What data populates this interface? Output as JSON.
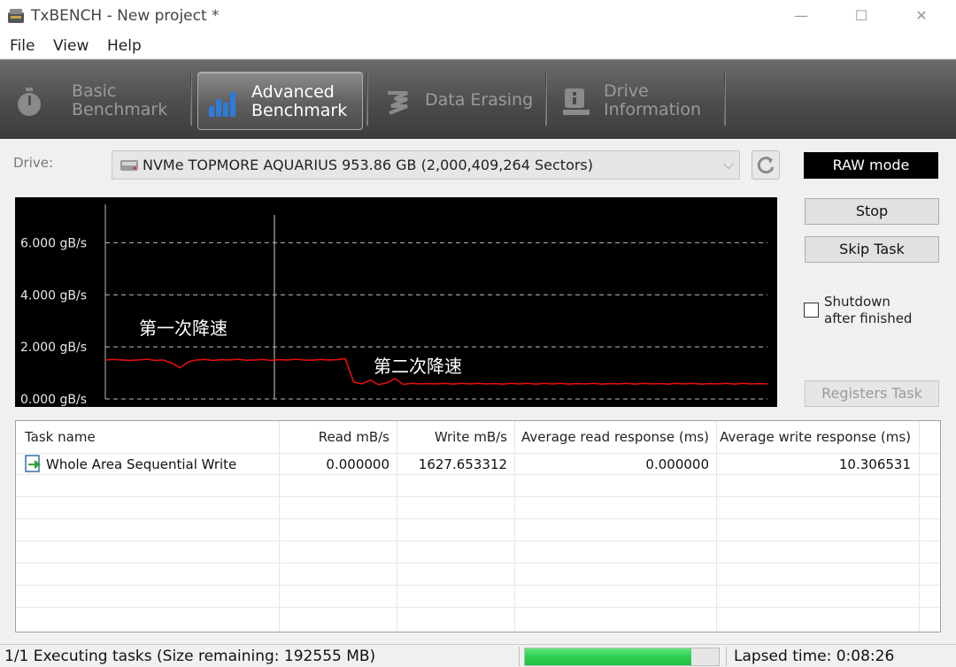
{
  "window": {
    "title": "TxBENCH - New project *",
    "minimize_glyph": "—",
    "maximize_glyph": "☐",
    "close_glyph": "✕"
  },
  "menu": {
    "items": [
      "File",
      "View",
      "Help"
    ]
  },
  "tabs": [
    {
      "label": "Basic\nBenchmark",
      "icon": "stopwatch-icon",
      "active": false
    },
    {
      "label": "Advanced\nBenchmark",
      "icon": "bar-chart-icon",
      "active": true
    },
    {
      "label": "Data Erasing",
      "icon": "eraser-icon",
      "active": false
    },
    {
      "label": "Drive\nInformation",
      "icon": "drive-info-icon",
      "active": false
    }
  ],
  "drive": {
    "label": "Drive:",
    "selected": "NVMe TOPMORE AQUARIUS  953.86 GB (2,000,409,264 Sectors)"
  },
  "side": {
    "raw_mode": "RAW mode",
    "stop": "Stop",
    "skip_task": "Skip Task",
    "shutdown": "Shutdown\nafter finished",
    "registers_task": "Registers Task"
  },
  "chart_data": {
    "type": "line",
    "y_unit": "gB/s",
    "y_ticks": [
      "6.000 gB/s",
      "4.000 gB/s",
      "2.000 gB/s",
      "0.000 gB/s"
    ],
    "ylim": [
      0,
      7
    ],
    "grid": true,
    "series_color": "#e01010",
    "annotations": [
      "第一次降速",
      "第二次降速"
    ],
    "series": [
      {
        "values": [
          1.5,
          1.52,
          1.5,
          1.48,
          1.5,
          1.53,
          1.48,
          1.5,
          1.38,
          1.2,
          1.42,
          1.5,
          1.52,
          1.48,
          1.51,
          1.5,
          1.53,
          1.49,
          1.5,
          1.52,
          1.48,
          1.51,
          1.5,
          1.53,
          1.5,
          1.49,
          1.52,
          1.5,
          1.51,
          1.55,
          0.65,
          0.58,
          0.72,
          0.55,
          0.62,
          0.78,
          0.56,
          0.6,
          0.58,
          0.59,
          0.58,
          0.6,
          0.57,
          0.6,
          0.58,
          0.6,
          0.58,
          0.59,
          0.57,
          0.6,
          0.58,
          0.6,
          0.57,
          0.6,
          0.58,
          0.6,
          0.57,
          0.59,
          0.58,
          0.6,
          0.57,
          0.59,
          0.58,
          0.6,
          0.57,
          0.6,
          0.58,
          0.59,
          0.57,
          0.6,
          0.58,
          0.6,
          0.57,
          0.59,
          0.58,
          0.6,
          0.57,
          0.6,
          0.58,
          0.59,
          0.58
        ]
      }
    ]
  },
  "table": {
    "headers": [
      "Task name",
      "Read mB/s",
      "Write mB/s",
      "Average read response (ms)",
      "Average write response (ms)"
    ],
    "rows": [
      [
        "Whole Area Sequential Write",
        "0.000000",
        "1627.653312",
        "0.000000",
        "10.306531"
      ]
    ]
  },
  "status": {
    "text": "1/1 Executing tasks (Size remaining: 192555 MB)",
    "progress": 0.86,
    "lapsed": "Lapsed time: 0:08:26"
  }
}
